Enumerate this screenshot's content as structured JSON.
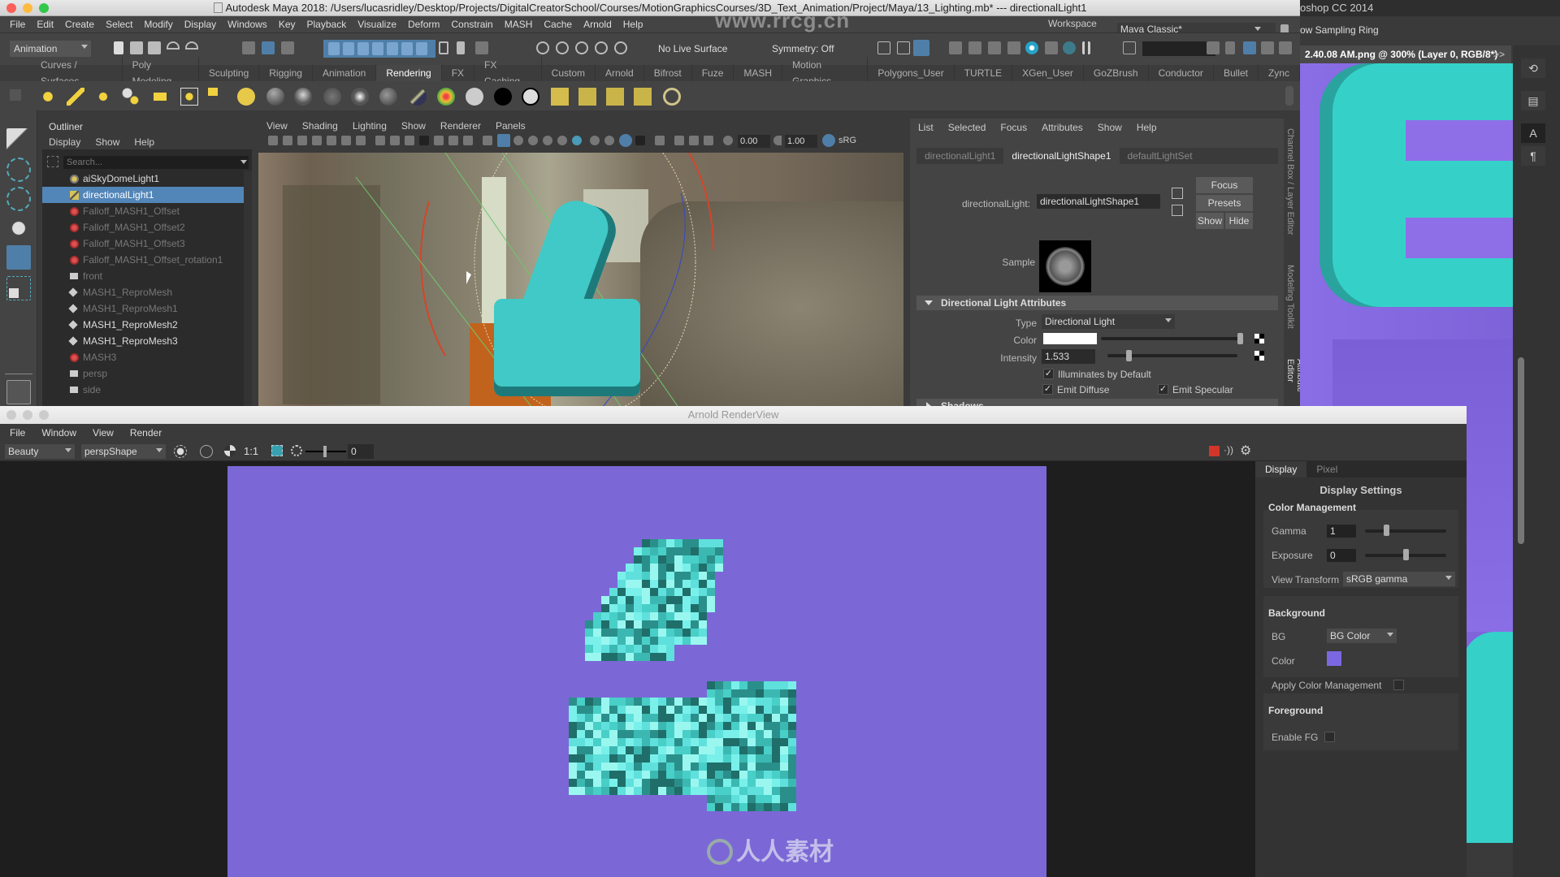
{
  "window": {
    "title": "Autodesk Maya 2018: /Users/lucasridley/Desktop/Projects/DigitalCreatorSchool/Courses/MotionGraphicsCourses/3D_Text_Animation/Project/Maya/13_Lighting.mb*  ---  directionalLight1",
    "watermark_url": "www.rrcg.cn"
  },
  "main_menu": [
    "File",
    "Edit",
    "Create",
    "Select",
    "Modify",
    "Display",
    "Windows",
    "Key",
    "Playback",
    "Visualize",
    "Deform",
    "Constrain",
    "MASH",
    "Cache",
    "Arnold",
    "Help"
  ],
  "workspace": {
    "label": "Workspace :",
    "value": "Maya Classic*"
  },
  "status_line": {
    "mode": "Animation",
    "live_surface": "No Live Surface",
    "symmetry": "Symmetry: Off"
  },
  "shelf_tabs": [
    "Curves / Surfaces",
    "Poly Modeling",
    "Sculpting",
    "Rigging",
    "Animation",
    "Rendering",
    "FX",
    "FX Caching",
    "Custom",
    "Arnold",
    "Bifrost",
    "Fuze",
    "MASH",
    "Motion Graphics",
    "Polygons_User",
    "TURTLE",
    "XGen_User",
    "GoZBrush",
    "Conductor",
    "Bullet",
    "Zync"
  ],
  "active_shelf_tab": "Rendering",
  "outliner": {
    "title": "Outliner",
    "menu": [
      "Display",
      "Show",
      "Help"
    ],
    "search_placeholder": "Search...",
    "items": [
      {
        "label": "aiSkyDomeLight1",
        "icon": "skydome-light-icon",
        "dim": false,
        "selected": false
      },
      {
        "label": "directionalLight1",
        "icon": "directional-light-icon",
        "dim": false,
        "selected": true
      },
      {
        "label": "Falloff_MASH1_Offset",
        "icon": "falloff-icon",
        "dim": true,
        "selected": false
      },
      {
        "label": "Falloff_MASH1_Offset2",
        "icon": "falloff-icon",
        "dim": true,
        "selected": false
      },
      {
        "label": "Falloff_MASH1_Offset3",
        "icon": "falloff-icon",
        "dim": true,
        "selected": false
      },
      {
        "label": "Falloff_MASH1_Offset_rotation1",
        "icon": "falloff-icon",
        "dim": true,
        "selected": false
      },
      {
        "label": "front",
        "icon": "camera-icon",
        "dim": true,
        "selected": false
      },
      {
        "label": "MASH1_ReproMesh",
        "icon": "mash-icon",
        "dim": true,
        "selected": false
      },
      {
        "label": "MASH1_ReproMesh1",
        "icon": "mash-icon",
        "dim": true,
        "selected": false
      },
      {
        "label": "MASH1_ReproMesh2",
        "icon": "mash-icon",
        "dim": false,
        "selected": false
      },
      {
        "label": "MASH1_ReproMesh3",
        "icon": "mash-icon",
        "dim": false,
        "selected": false
      },
      {
        "label": "MASH3",
        "icon": "falloff-icon",
        "dim": true,
        "selected": false
      },
      {
        "label": "persp",
        "icon": "camera-icon",
        "dim": true,
        "selected": false
      },
      {
        "label": "side",
        "icon": "camera-icon",
        "dim": true,
        "selected": false
      }
    ]
  },
  "viewport": {
    "menu": [
      "View",
      "Shading",
      "Lighting",
      "Show",
      "Renderer",
      "Panels"
    ],
    "exposure": "0.00",
    "gamma": "1.00",
    "color_space": "sRG"
  },
  "attribute_editor": {
    "menu": [
      "List",
      "Selected",
      "Focus",
      "Attributes",
      "Show",
      "Help"
    ],
    "tabs": [
      "directionalLight1",
      "directionalLightShape1",
      "defaultLightSet"
    ],
    "active_tab": "directionalLightShape1",
    "node_label": "directionalLight:",
    "node_value": "directionalLightShape1",
    "buttons": {
      "focus": "Focus",
      "presets": "Presets",
      "show": "Show",
      "hide": "Hide"
    },
    "sample_label": "Sample",
    "section_title": "Directional Light Attributes",
    "type_label": "Type",
    "type_value": "Directional Light",
    "color_label": "Color",
    "color_value": "#ffffff",
    "color_slider": 1.0,
    "intensity_label": "Intensity",
    "intensity_value": "1.533",
    "intensity_slider": 0.15,
    "illuminates_label": "Illuminates by Default",
    "illuminates_checked": true,
    "emit_diffuse_label": "Emit Diffuse",
    "emit_diffuse_checked": true,
    "emit_specular_label": "Emit Specular",
    "emit_specular_checked": true,
    "next_section": "Shadows"
  },
  "side_tabs": [
    "Channel Box / Layer Editor",
    "Modeling Toolkit",
    "Attribute Editor"
  ],
  "photoshop": {
    "title": "oshop CC 2014",
    "options_text": "ow Sampling Ring",
    "doc_tab": "2.40.08 AM.png @ 300% (Layer 0, RGB/8*)",
    "overflow": ">>"
  },
  "render_view": {
    "title": "Arnold RenderView",
    "menu": [
      "File",
      "Window",
      "View",
      "Render"
    ],
    "aov": "Beauty",
    "camera": "perspShape",
    "zoom": "1:1",
    "slider_value": "0",
    "background_color": "#7b68d6",
    "settings_tabs": [
      "Display",
      "Pixel"
    ],
    "active_settings_tab": "Display",
    "settings_title": "Display Settings",
    "color_management": {
      "title": "Color Management",
      "gamma_label": "Gamma",
      "gamma_value": "1",
      "gamma_slider": 0.25,
      "exposure_label": "Exposure",
      "exposure_value": "0",
      "exposure_slider": 0.5,
      "view_transform_label": "View Transform",
      "view_transform_value": "sRGB gamma"
    },
    "background": {
      "title": "Background",
      "bg_label": "BG",
      "bg_value": "BG Color",
      "color_label": "Color",
      "color_value": "#7b68e0",
      "apply_cm_label": "Apply Color Management",
      "apply_cm_checked": false
    },
    "foreground": {
      "title": "Foreground",
      "enable_fg_label": "Enable FG",
      "enable_fg_checked": false
    },
    "logo_text": "人人素材"
  }
}
